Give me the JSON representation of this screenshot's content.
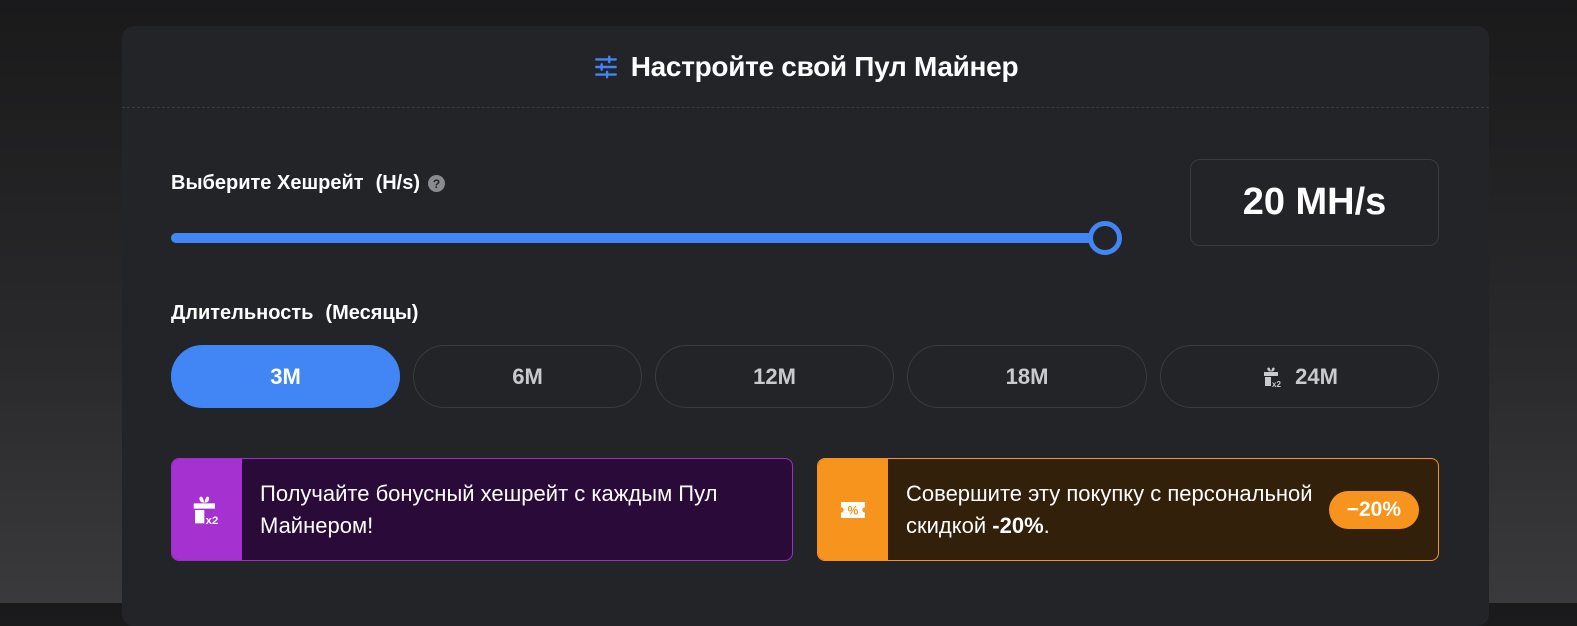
{
  "header": {
    "title": "Настройте свой Пул Майнер",
    "icon": "settings-sliders-icon",
    "icon_color": "#4285f4"
  },
  "hashrate": {
    "label": "Выберите Хешрейт",
    "unit": "(H/s)",
    "help_icon": "question-icon",
    "value_display": "20 MH/s",
    "slider_fraction": 1.0,
    "accent_color": "#4285f4"
  },
  "duration": {
    "label": "Длительность",
    "unit": "(Месяцы)",
    "options": [
      {
        "label": "3M",
        "active": true
      },
      {
        "label": "6M",
        "active": false
      },
      {
        "label": "12M",
        "active": false
      },
      {
        "label": "18M",
        "active": false
      },
      {
        "label": "24M",
        "active": false,
        "icon": "gift-x2-icon"
      }
    ]
  },
  "promos": {
    "bonus": {
      "text": "Получайте бонусный хешрейт с каждым Пул Майнером!",
      "icon": "gift-x2-icon",
      "color": "#a531d0"
    },
    "discount": {
      "text_before": "Совершите эту покупку с персональной скидкой ",
      "text_bold": "-20%",
      "text_after": ".",
      "badge": "−20%",
      "icon": "coupon-percent-icon",
      "color": "#f7941d"
    }
  }
}
